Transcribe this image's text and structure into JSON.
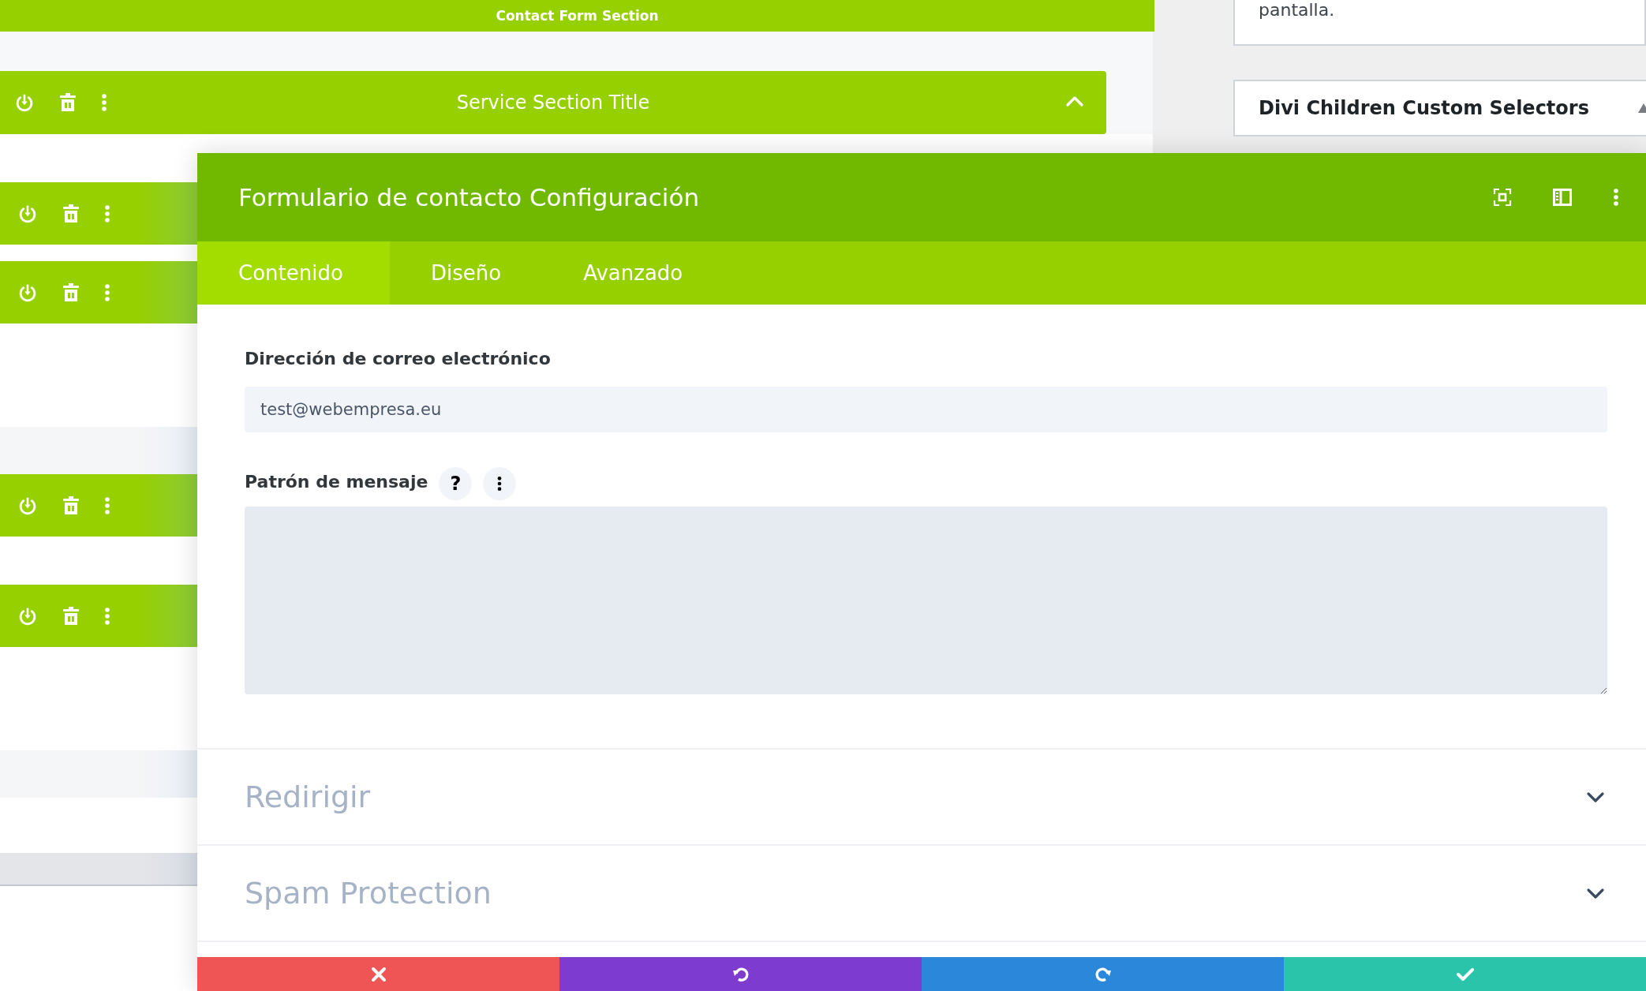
{
  "builder": {
    "top_section": {
      "title": "Contact Form Section"
    },
    "service_section": {
      "title": "Service Section Title",
      "expanded": true
    },
    "rows": [
      {
        "kind": "bar"
      },
      {
        "kind": "bar"
      },
      {
        "kind": "band"
      },
      {
        "kind": "bar"
      },
      {
        "kind": "bar"
      },
      {
        "kind": "band"
      },
      {
        "kind": "shade"
      }
    ]
  },
  "sidebar": {
    "note": "pantalla.",
    "panel_title": "Divi Children Custom Selectors"
  },
  "modal": {
    "title": "Formulario de contacto Configuración",
    "tabs": [
      {
        "label": "Contenido",
        "selected": true
      },
      {
        "label": "Diseño",
        "selected": false
      },
      {
        "label": "Avanzado",
        "selected": false
      }
    ],
    "fields": [
      {
        "kind": "input",
        "label": "Dirección de correo electrónico",
        "value": "test@webempresa.eu"
      },
      {
        "kind": "textarea",
        "label": "Patrón de mensaje",
        "help": "?"
      }
    ],
    "sections": [
      {
        "title": "Redirigir",
        "expanded": false
      },
      {
        "title": "Spam Protection",
        "expanded": false
      }
    ],
    "footer_buttons": [
      {
        "kind": "cancel",
        "color": "#ef5555"
      },
      {
        "kind": "undo",
        "color": "#7e3bd0"
      },
      {
        "kind": "redo",
        "color": "#2b87da"
      },
      {
        "kind": "save",
        "color": "#29c4a9"
      }
    ]
  }
}
